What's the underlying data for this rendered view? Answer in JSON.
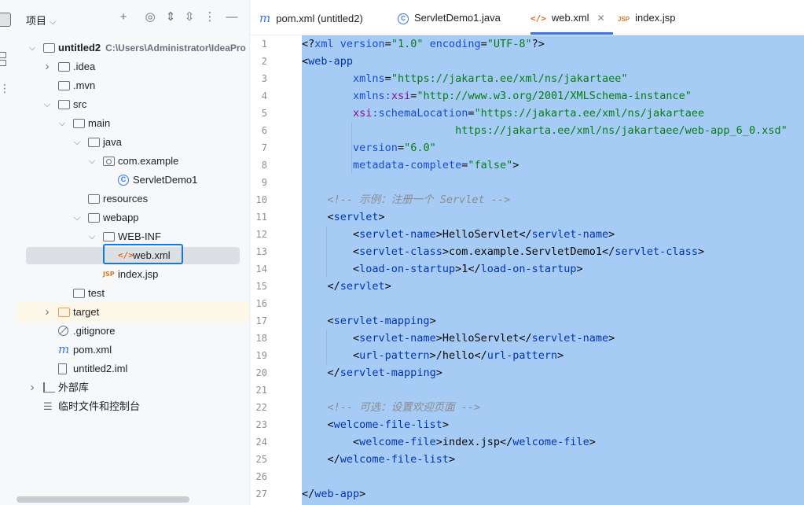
{
  "project_panel": {
    "title": "项目",
    "tree": [
      {
        "key": "untitled2",
        "label": "untitled2",
        "path": "C:\\Users\\Administrator\\IdeaPro",
        "icon": "module-folder-icon",
        "arrow": "expanded",
        "depth": 0,
        "bold": true
      },
      {
        "key": "idea",
        "label": ".idea",
        "icon": "folder-icon",
        "arrow": "collapsed",
        "depth": 1
      },
      {
        "key": "mvn",
        "label": ".mvn",
        "icon": "folder-icon",
        "arrow": "none",
        "depth": 1
      },
      {
        "key": "src",
        "label": "src",
        "icon": "folder-icon",
        "arrow": "expanded",
        "depth": 1
      },
      {
        "key": "main",
        "label": "main",
        "icon": "folder-icon",
        "arrow": "expanded",
        "depth": 2
      },
      {
        "key": "java",
        "label": "java",
        "icon": "source-folder-icon",
        "arrow": "expanded",
        "depth": 3
      },
      {
        "key": "com_example",
        "label": "com.example",
        "icon": "package-icon",
        "arrow": "expanded",
        "depth": 4
      },
      {
        "key": "servletdemo1",
        "label": "ServletDemo1",
        "icon": "class-icon",
        "arrow": "none",
        "depth": 5
      },
      {
        "key": "resources",
        "label": "resources",
        "icon": "resources-folder-icon",
        "arrow": "none",
        "depth": 3
      },
      {
        "key": "webapp",
        "label": "webapp",
        "icon": "web-folder-icon",
        "arrow": "expanded",
        "depth": 3
      },
      {
        "key": "webinf",
        "label": "WEB-INF",
        "icon": "folder-icon",
        "arrow": "expanded",
        "depth": 4
      },
      {
        "key": "webxml",
        "label": "web.xml",
        "icon": "xml-file-icon",
        "arrow": "none",
        "depth": 5,
        "selected": true
      },
      {
        "key": "indexjsp",
        "label": "index.jsp",
        "icon": "jsp-file-icon",
        "arrow": "none",
        "depth": 4
      },
      {
        "key": "test",
        "label": "test",
        "icon": "folder-icon",
        "arrow": "none",
        "depth": 2
      },
      {
        "key": "target",
        "label": "target",
        "icon": "excluded-folder-icon",
        "arrow": "collapsed",
        "depth": 1
      },
      {
        "key": "gitignore",
        "label": ".gitignore",
        "icon": "ignore-file-icon",
        "arrow": "none",
        "depth": 1
      },
      {
        "key": "pomxml",
        "label": "pom.xml",
        "icon": "maven-file-icon",
        "arrow": "none",
        "depth": 1
      },
      {
        "key": "iml",
        "label": "untitled2.iml",
        "icon": "iml-file-icon",
        "arrow": "none",
        "depth": 1
      },
      {
        "key": "extlibs",
        "label": "外部库",
        "icon": "library-icon",
        "arrow": "collapsed",
        "depth": 0
      },
      {
        "key": "scratches",
        "label": "临时文件和控制台",
        "icon": "scratches-icon",
        "arrow": "none",
        "depth": 0
      }
    ]
  },
  "tabs": [
    {
      "label": "pom.xml (untitled2)",
      "icon": "maven-file-icon",
      "active": false
    },
    {
      "label": "ServletDemo1.java",
      "icon": "class-icon",
      "active": false
    },
    {
      "label": "web.xml",
      "icon": "xml-file-icon",
      "active": true
    },
    {
      "label": "index.jsp",
      "icon": "jsp-file-icon",
      "active": false
    }
  ],
  "editor": {
    "file": "web.xml",
    "lines": [
      [
        {
          "c": "",
          "t": "<?"
        },
        {
          "c": "an",
          "t": "xml version"
        },
        {
          "c": "",
          "t": "="
        },
        {
          "c": "av",
          "t": "\"1.0\""
        },
        {
          "c": "an",
          "t": " encoding"
        },
        {
          "c": "",
          "t": "="
        },
        {
          "c": "av",
          "t": "\"UTF-8\""
        },
        {
          "c": "",
          "t": "?>"
        }
      ],
      [
        {
          "c": "",
          "t": "<"
        },
        {
          "c": "tg",
          "t": "web-app"
        }
      ],
      [
        {
          "c": "",
          "t": "        "
        },
        {
          "c": "an",
          "t": "xmlns"
        },
        {
          "c": "",
          "t": "="
        },
        {
          "c": "av",
          "t": "\"https://jakarta.ee/xml/ns/jakartaee\""
        }
      ],
      [
        {
          "c": "",
          "t": "        "
        },
        {
          "c": "an",
          "t": "xmlns:"
        },
        {
          "c": "ns",
          "t": "xsi"
        },
        {
          "c": "",
          "t": "="
        },
        {
          "c": "av",
          "t": "\"http://www.w3.org/2001/XMLSchema-instance\""
        }
      ],
      [
        {
          "c": "",
          "t": "        "
        },
        {
          "c": "ns",
          "t": "xsi"
        },
        {
          "c": "an",
          "t": ":schemaLocation"
        },
        {
          "c": "",
          "t": "="
        },
        {
          "c": "av",
          "t": "\"https://jakarta.ee/xml/ns/jakartaee"
        }
      ],
      [
        {
          "c": "av",
          "t": "                        https://jakarta.ee/xml/ns/jakartaee/web-app_6_0.xsd\""
        }
      ],
      [
        {
          "c": "",
          "t": "        "
        },
        {
          "c": "an",
          "t": "version"
        },
        {
          "c": "",
          "t": "="
        },
        {
          "c": "av",
          "t": "\"6.0\""
        }
      ],
      [
        {
          "c": "",
          "t": "        "
        },
        {
          "c": "an",
          "t": "metadata-complete"
        },
        {
          "c": "",
          "t": "="
        },
        {
          "c": "av",
          "t": "\"false\""
        },
        {
          "c": "",
          "t": ">"
        }
      ],
      [],
      [
        {
          "c": "cm",
          "t": "    <!-- 示例：注册一个 Servlet -->"
        }
      ],
      [
        {
          "c": "",
          "t": "    <"
        },
        {
          "c": "tg",
          "t": "servlet"
        },
        {
          "c": "",
          "t": ">"
        }
      ],
      [
        {
          "c": "",
          "t": "        <"
        },
        {
          "c": "tg",
          "t": "servlet-name"
        },
        {
          "c": "",
          "t": ">HelloServlet</"
        },
        {
          "c": "tg",
          "t": "servlet-name"
        },
        {
          "c": "",
          "t": ">"
        }
      ],
      [
        {
          "c": "",
          "t": "        <"
        },
        {
          "c": "tg",
          "t": "servlet-class"
        },
        {
          "c": "",
          "t": ">com.example.ServletDemo1</"
        },
        {
          "c": "tg",
          "t": "servlet-class"
        },
        {
          "c": "",
          "t": ">"
        }
      ],
      [
        {
          "c": "",
          "t": "        <"
        },
        {
          "c": "tg",
          "t": "load-on-startup"
        },
        {
          "c": "",
          "t": ">1</"
        },
        {
          "c": "tg",
          "t": "load-on-startup"
        },
        {
          "c": "",
          "t": ">"
        }
      ],
      [
        {
          "c": "",
          "t": "    </"
        },
        {
          "c": "tg",
          "t": "servlet"
        },
        {
          "c": "",
          "t": ">"
        }
      ],
      [],
      [
        {
          "c": "",
          "t": "    <"
        },
        {
          "c": "tg",
          "t": "servlet-mapping"
        },
        {
          "c": "",
          "t": ">"
        }
      ],
      [
        {
          "c": "",
          "t": "        <"
        },
        {
          "c": "tg",
          "t": "servlet-name"
        },
        {
          "c": "",
          "t": ">HelloServlet</"
        },
        {
          "c": "tg",
          "t": "servlet-name"
        },
        {
          "c": "",
          "t": ">"
        }
      ],
      [
        {
          "c": "",
          "t": "        <"
        },
        {
          "c": "tg",
          "t": "url-pattern"
        },
        {
          "c": "",
          "t": ">/hello</"
        },
        {
          "c": "tg",
          "t": "url-pattern"
        },
        {
          "c": "",
          "t": ">"
        }
      ],
      [
        {
          "c": "",
          "t": "    </"
        },
        {
          "c": "tg",
          "t": "servlet-mapping"
        },
        {
          "c": "",
          "t": ">"
        }
      ],
      [],
      [
        {
          "c": "cm",
          "t": "    <!-- 可选：设置欢迎页面 -->"
        }
      ],
      [
        {
          "c": "",
          "t": "    <"
        },
        {
          "c": "tg",
          "t": "welcome-file-list"
        },
        {
          "c": "",
          "t": ">"
        }
      ],
      [
        {
          "c": "",
          "t": "        <"
        },
        {
          "c": "tg",
          "t": "welcome-file"
        },
        {
          "c": "",
          "t": ">index.jsp</"
        },
        {
          "c": "tg",
          "t": "welcome-file"
        },
        {
          "c": "",
          "t": ">"
        }
      ],
      [
        {
          "c": "",
          "t": "    </"
        },
        {
          "c": "tg",
          "t": "welcome-file-list"
        },
        {
          "c": "",
          "t": ">"
        }
      ],
      [],
      [
        {
          "c": "",
          "t": "</"
        },
        {
          "c": "tg",
          "t": "web-app"
        },
        {
          "c": "",
          "t": ">"
        }
      ]
    ]
  }
}
